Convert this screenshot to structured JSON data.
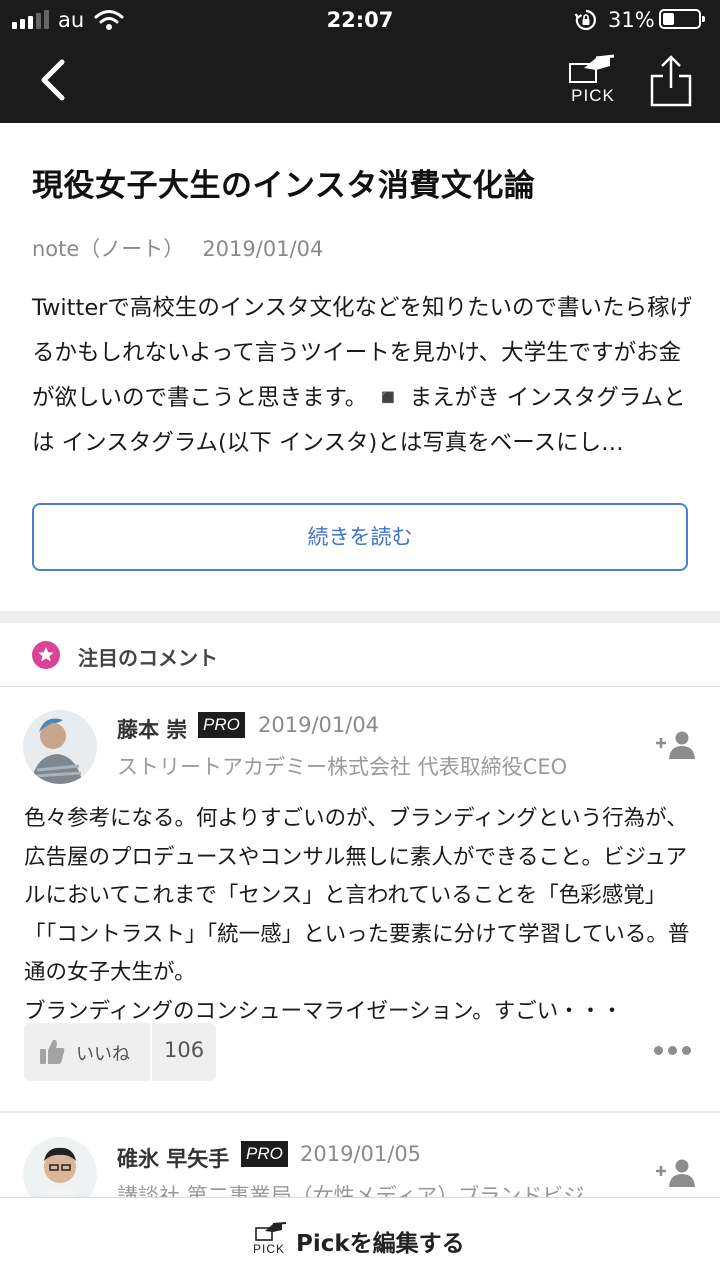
{
  "status_bar": {
    "carrier": "au",
    "time": "22:07",
    "battery_percent": "31%",
    "battery_level": 0.31
  },
  "nav": {
    "back_icon": "chevron-left-icon",
    "pick_label": "PICK",
    "share_icon": "share-icon"
  },
  "article": {
    "title": "現役女子大生のインスタ消費文化論",
    "source": "note（ノート）",
    "date": "2019/01/04",
    "excerpt": "Twitterで高校生のインスタ文化などを知りたいので書いたら稼げるかもしれないよって言うツイートを見かけ、大学生ですがお金が欲しいので書こうと思きます。 ◾️ まえがき インスタグラムとは インスタグラム(以下 インスタ)とは写真をベースにし…",
    "read_more": "続きを読む"
  },
  "section": {
    "title": "注目のコメント",
    "icon": "star-icon",
    "accent_color": "#d94497"
  },
  "comments": [
    {
      "name": "藤本 崇",
      "badge": "PRO",
      "date": "2019/01/04",
      "subtitle": "ストリートアカデミー株式会社 代表取締役CEO",
      "body": "色々参考になる。何よりすごいのが、ブランディングという行為が、広告屋のプロデュースやコンサル無しに素人ができること。ビジュアルにおいてこれまで「センス」と言われていることを「色彩感覚」「「コントラスト」「統一感」といった要素に分けて学習している。普通の女子大生が。\nブランディングのコンシューマライゼーション。すごい・・・",
      "like_label": "いいね",
      "like_count": "106"
    },
    {
      "name": "碓氷 早矢手",
      "badge": "PRO",
      "date": "2019/01/05",
      "subtitle": "講談社 第二事業局（女性メディア）ブランドビジ…"
    }
  ],
  "bottom_bar": {
    "pick_label": "PICK",
    "edit_label": "Pickを編集する"
  }
}
